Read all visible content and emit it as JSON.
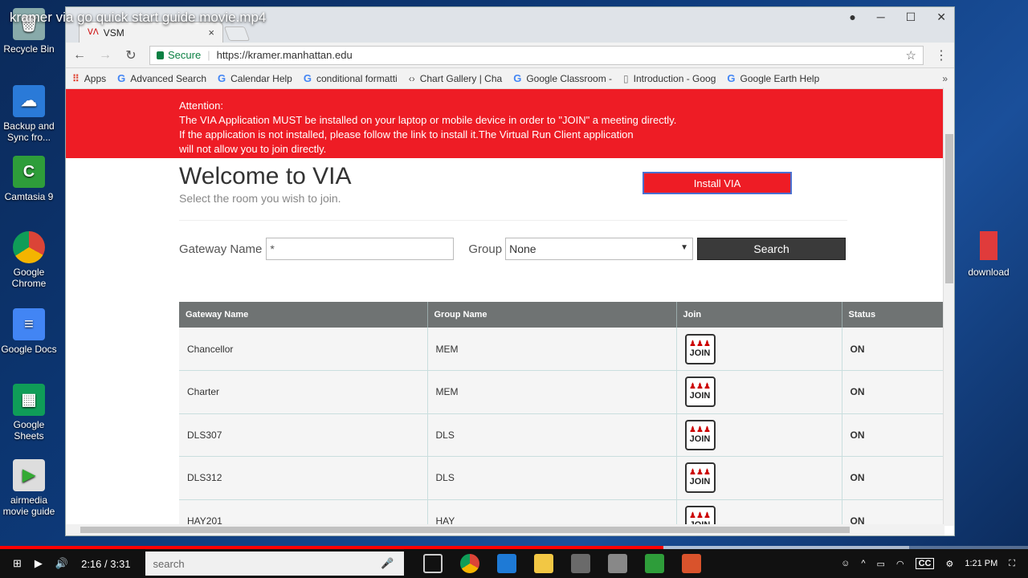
{
  "video": {
    "title": "kramer via go quick start guide movie.mp4",
    "time": "2:16 / 3:31",
    "progress": 0.645
  },
  "desktop": {
    "icons": [
      {
        "label": "Recycle Bin"
      },
      {
        "label": "Backup and Sync fro..."
      },
      {
        "label": "Camtasia 9"
      },
      {
        "label": "Google Chrome"
      },
      {
        "label": "Google Docs"
      },
      {
        "label": "Google Sheets"
      },
      {
        "label": "airmedia movie guide"
      }
    ],
    "right_icon": "download"
  },
  "browser": {
    "tab_title": "VSM",
    "tab_close": "×",
    "secure_label": "Secure",
    "url": "https://kramer.manhattan.edu",
    "bookmarks": [
      "Apps",
      "Advanced Search",
      "Calendar Help",
      "conditional formatti",
      "Chart Gallery | Cha",
      "Google Classroom -",
      "Introduction - Goog",
      "Google Earth Help"
    ],
    "bookmarks_more": "»"
  },
  "banner": {
    "line1": "Attention:",
    "line2": "The VIA Application MUST be installed on your laptop or mobile device in order to \"JOIN\" a meeting directly.",
    "line3": "If the application is not installed, please follow the link to install it.The Virtual Run Client application",
    "line4": "will not allow you to join directly."
  },
  "welcome": {
    "title": "Welcome to VIA",
    "subtitle": "Select the room you wish to join."
  },
  "install_label": "Install VIA",
  "form": {
    "gateway_label": "Gateway Name",
    "gateway_value": "*",
    "group_label": "Group",
    "group_value": "None",
    "search_label": "Search"
  },
  "table": {
    "headers": [
      "Gateway Name",
      "Group Name",
      "Join",
      "Status"
    ],
    "join_text": "JOIN",
    "rows": [
      {
        "gateway": "Chancellor",
        "group": "MEM",
        "status": "ON"
      },
      {
        "gateway": "Charter",
        "group": "MEM",
        "status": "ON"
      },
      {
        "gateway": "DLS307",
        "group": "DLS",
        "status": "ON"
      },
      {
        "gateway": "DLS312",
        "group": "DLS",
        "status": "ON"
      },
      {
        "gateway": "HAY201",
        "group": "HAY",
        "status": "ON"
      }
    ]
  },
  "taskbar": {
    "search_placeholder": "search",
    "clock": "1:21 PM"
  }
}
